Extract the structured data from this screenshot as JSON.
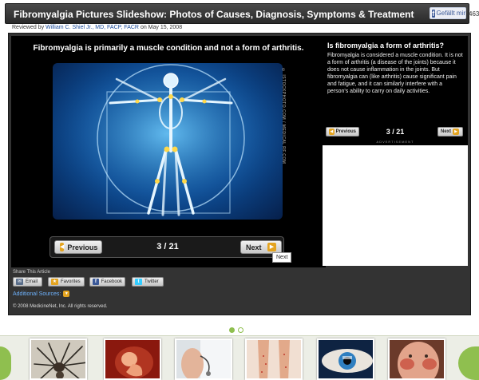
{
  "header": {
    "title": "Fibromyalgia Pictures Slideshow: Photos of Causes, Diagnosis, Symptoms & Treatment",
    "fb_like_label": "Gefällt mir",
    "fb_count": "463"
  },
  "review": {
    "prefix": "Reviewed by",
    "author": "William C. Shiel Jr., MD, FACP, FACR",
    "suffix": "on May 15, 2008"
  },
  "slide": {
    "heading": "Fibromyalgia is primarily a muscle condition and not a form of arthritis.",
    "image_credit": "© ISTOCKPHOTO.COM / MEDICAL RF.COM",
    "prev_label": "Previous",
    "next_label": "Next",
    "counter": "3 / 21",
    "next_tooltip": "Next"
  },
  "caption": {
    "title": "Is fibromyalgia a form of arthritis?",
    "text": "Fibromyalgia is considered a muscle condition. It is not a form of arthritis (a disease of the joints) because it does not cause inflammation in the joints. But fibromyalgia can (like arthritis) cause significant pain and fatigue, and it can similarly interfere with a person's ability to carry on daily activities.",
    "prev_label": "Previous",
    "next_label": "Next",
    "counter": "3 / 21",
    "ad_label": "ADVERTISEMENT"
  },
  "share": {
    "label": "Share This Article",
    "email": "Email",
    "favorites": "Favorites",
    "facebook": "Facebook",
    "twitter": "Twitter",
    "additional_sources": "Additional Sources:",
    "copyright": "© 2008 MedicineNet, Inc. All rights reserved."
  },
  "colors": {
    "accent_orange": "#e4a420",
    "panel_dark": "#333333",
    "strip_green": "#8fbf4f"
  }
}
